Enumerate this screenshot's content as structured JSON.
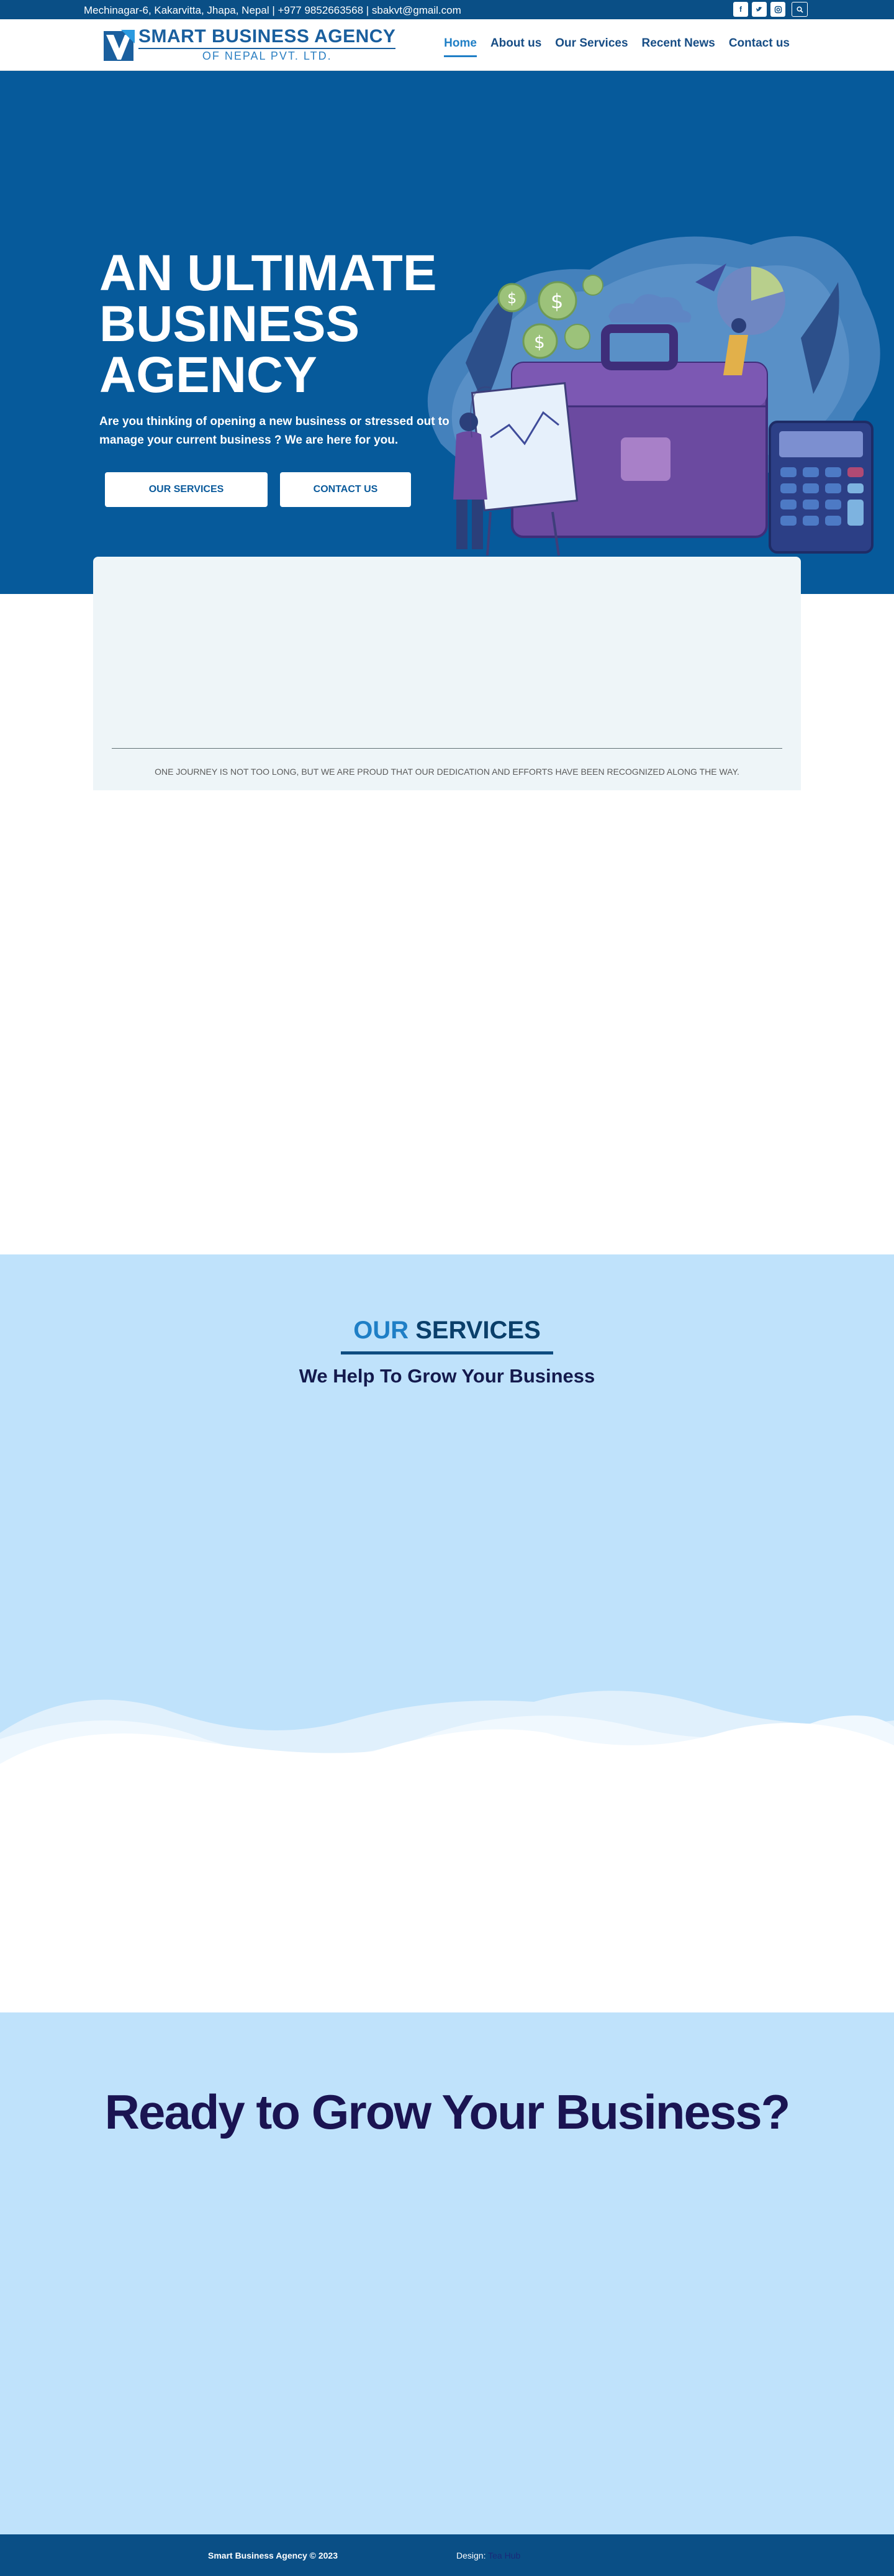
{
  "topbar": {
    "contact": "Mechinagar-6, Kakarvitta, Jhapa, Nepal | +977 9852663568 | sbakvt@gmail.com",
    "social_icons": [
      "facebook-icon",
      "twitter-icon",
      "instagram-icon"
    ],
    "search_icon": "search-icon"
  },
  "header": {
    "logo_title": "SMART BUSINESS AGENCY",
    "logo_subtitle": "OF NEPAL PVT. LTD.",
    "nav": [
      {
        "label": "Home",
        "active": true
      },
      {
        "label": "About us",
        "active": false
      },
      {
        "label": "Our Services",
        "active": false
      },
      {
        "label": "Recent News",
        "active": false
      },
      {
        "label": "Contact us",
        "active": false
      }
    ]
  },
  "hero": {
    "title": "AN ULTIMATE BUSINESS AGENCY",
    "lead": "Are you thinking of opening a new business or stressed out to manage your current business ? We are here for you.",
    "button_services": "OUR SERVICES",
    "button_contact": "CONTACT US"
  },
  "stats_card": {
    "journey_text": "ONE JOURNEY IS NOT TOO LONG, BUT WE ARE PROUD THAT OUR DEDICATION AND EFFORTS HAVE BEEN RECOGNIZED ALONG THE WAY."
  },
  "services": {
    "title_accent": "OUR",
    "title_rest": "SERVICES",
    "subtitle": "We Help To Grow Your Business"
  },
  "cta": {
    "title": "Ready to Grow Your Business?"
  },
  "footer": {
    "copyright": "Smart Business Agency © 2023",
    "design_label": "Design:",
    "design_link": "Tea Hub"
  },
  "colors": {
    "primary": "#065a9b",
    "dark_blue": "#0a4f86",
    "light_blue": "#bfe2fb",
    "accent": "#1f7fc6",
    "navy_text": "#1a1452"
  }
}
